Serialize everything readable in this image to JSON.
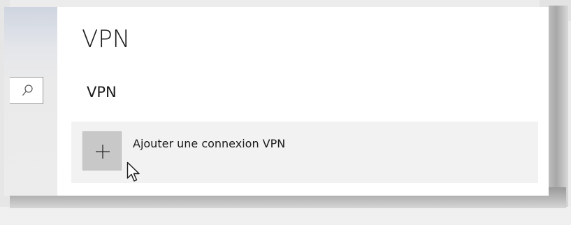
{
  "page": {
    "title": "VPN"
  },
  "section": {
    "title": "VPN"
  },
  "add_connection": {
    "label": "Ajouter une connexion VPN",
    "icon": "plus-icon"
  },
  "search": {
    "icon": "search-icon"
  },
  "colors": {
    "window_bg": "#ffffff",
    "nav_bg": "#ececec",
    "tile_bg": "#c8c8c8",
    "row_bg": "#f2f2f2",
    "text": "#1a1a1a"
  }
}
